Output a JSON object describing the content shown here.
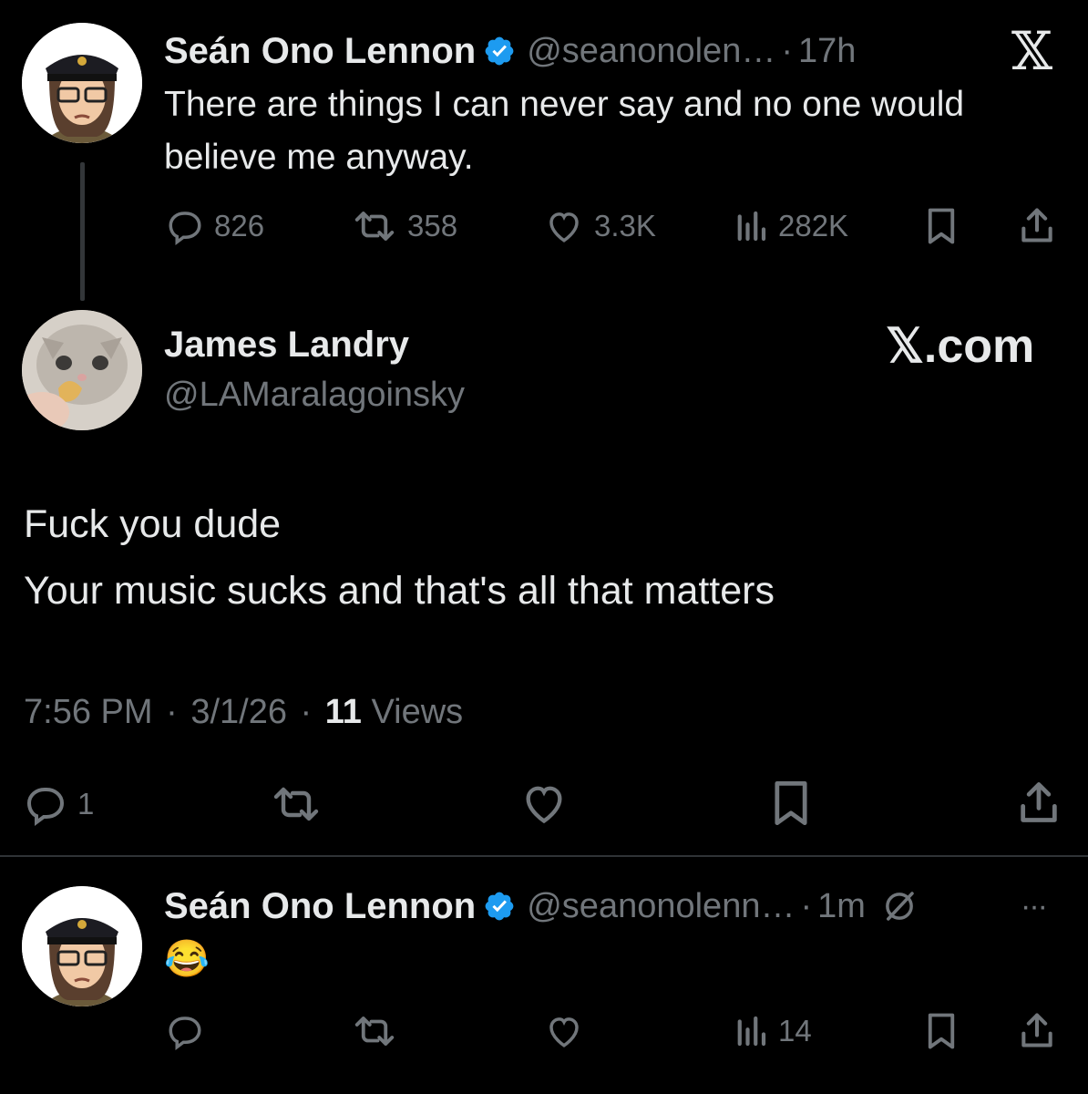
{
  "original_tweet": {
    "author_name": "Seán Ono Lennon",
    "author_handle": "@seanonolen…",
    "separator": "·",
    "time_ago": "17h",
    "text": "There are things I can never say and no one would believe me anyway.",
    "replies": "826",
    "reposts": "358",
    "likes": "3.3K",
    "views": "282K"
  },
  "reply_tweet": {
    "author_name": "James Landry",
    "author_handle": "@LAMaralagoinsky",
    "brand": "𝕏.com",
    "line1": "Fuck you dude",
    "line2": "Your music sucks and that's all that matters",
    "time": "7:56 PM",
    "date": "3/1/26",
    "sep": "·",
    "views_count": "11",
    "views_label": "Views",
    "replies": "1"
  },
  "response_tweet": {
    "author_name": "Seán Ono Lennon",
    "author_handle": "@seanonolenn…",
    "separator": "·",
    "time_ago": "1m",
    "text": "😂",
    "views": "14",
    "more": "···"
  },
  "x_logo": "𝕏",
  "colors": {
    "background": "#000000",
    "text": "#e7e9ea",
    "muted": "#71767b",
    "verified": "#1d9bf0",
    "divider": "#2f3336"
  }
}
